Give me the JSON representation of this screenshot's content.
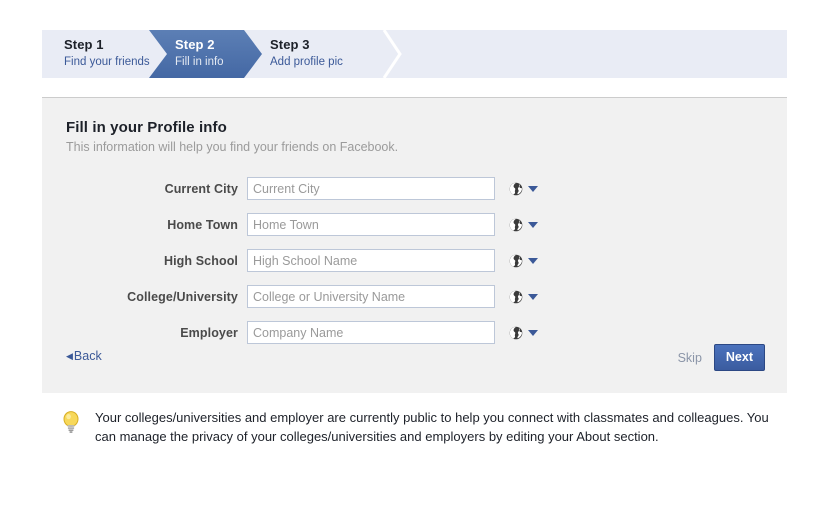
{
  "steps": [
    {
      "title": "Step 1",
      "subtitle": "Find your friends",
      "active": false
    },
    {
      "title": "Step 2",
      "subtitle": "Fill in info",
      "active": true
    },
    {
      "title": "Step 3",
      "subtitle": "Add profile pic",
      "active": false
    }
  ],
  "panel": {
    "title": "Fill in your Profile info",
    "subtitle": "This information will help you find your friends on Facebook."
  },
  "fields": [
    {
      "label": "Current City",
      "placeholder": "Current City",
      "value": "",
      "privacy_icon": "globe-icon"
    },
    {
      "label": "Home Town",
      "placeholder": "Home Town",
      "value": "",
      "privacy_icon": "globe-icon"
    },
    {
      "label": "High School",
      "placeholder": "High School Name",
      "value": "",
      "privacy_icon": "globe-icon"
    },
    {
      "label": "College/University",
      "placeholder": "College or University Name",
      "value": "",
      "privacy_icon": "globe-icon"
    },
    {
      "label": "Employer",
      "placeholder": "Company Name",
      "value": "",
      "privacy_icon": "globe-icon"
    }
  ],
  "actions": {
    "back_label": "Back",
    "back_arrow": "◀",
    "skip_label": "Skip",
    "next_label": "Next"
  },
  "notice": {
    "icon": "lightbulb-icon",
    "text": "Your colleges/universities and employer are currently public to help you connect with classmates and colleagues. You can manage the privacy of your colleges/universities and employers by editing your About section."
  },
  "colors": {
    "brand_blue": "#3b5998",
    "active_step_blue": "#4a6fa8",
    "stepbar_bg": "#e9ecf5",
    "panel_bg": "#f1f1f1",
    "next_button_bg": "#4267b2",
    "bulb_yellow": "#f5d04e",
    "placeholder_gray": "#9a9a9a"
  }
}
